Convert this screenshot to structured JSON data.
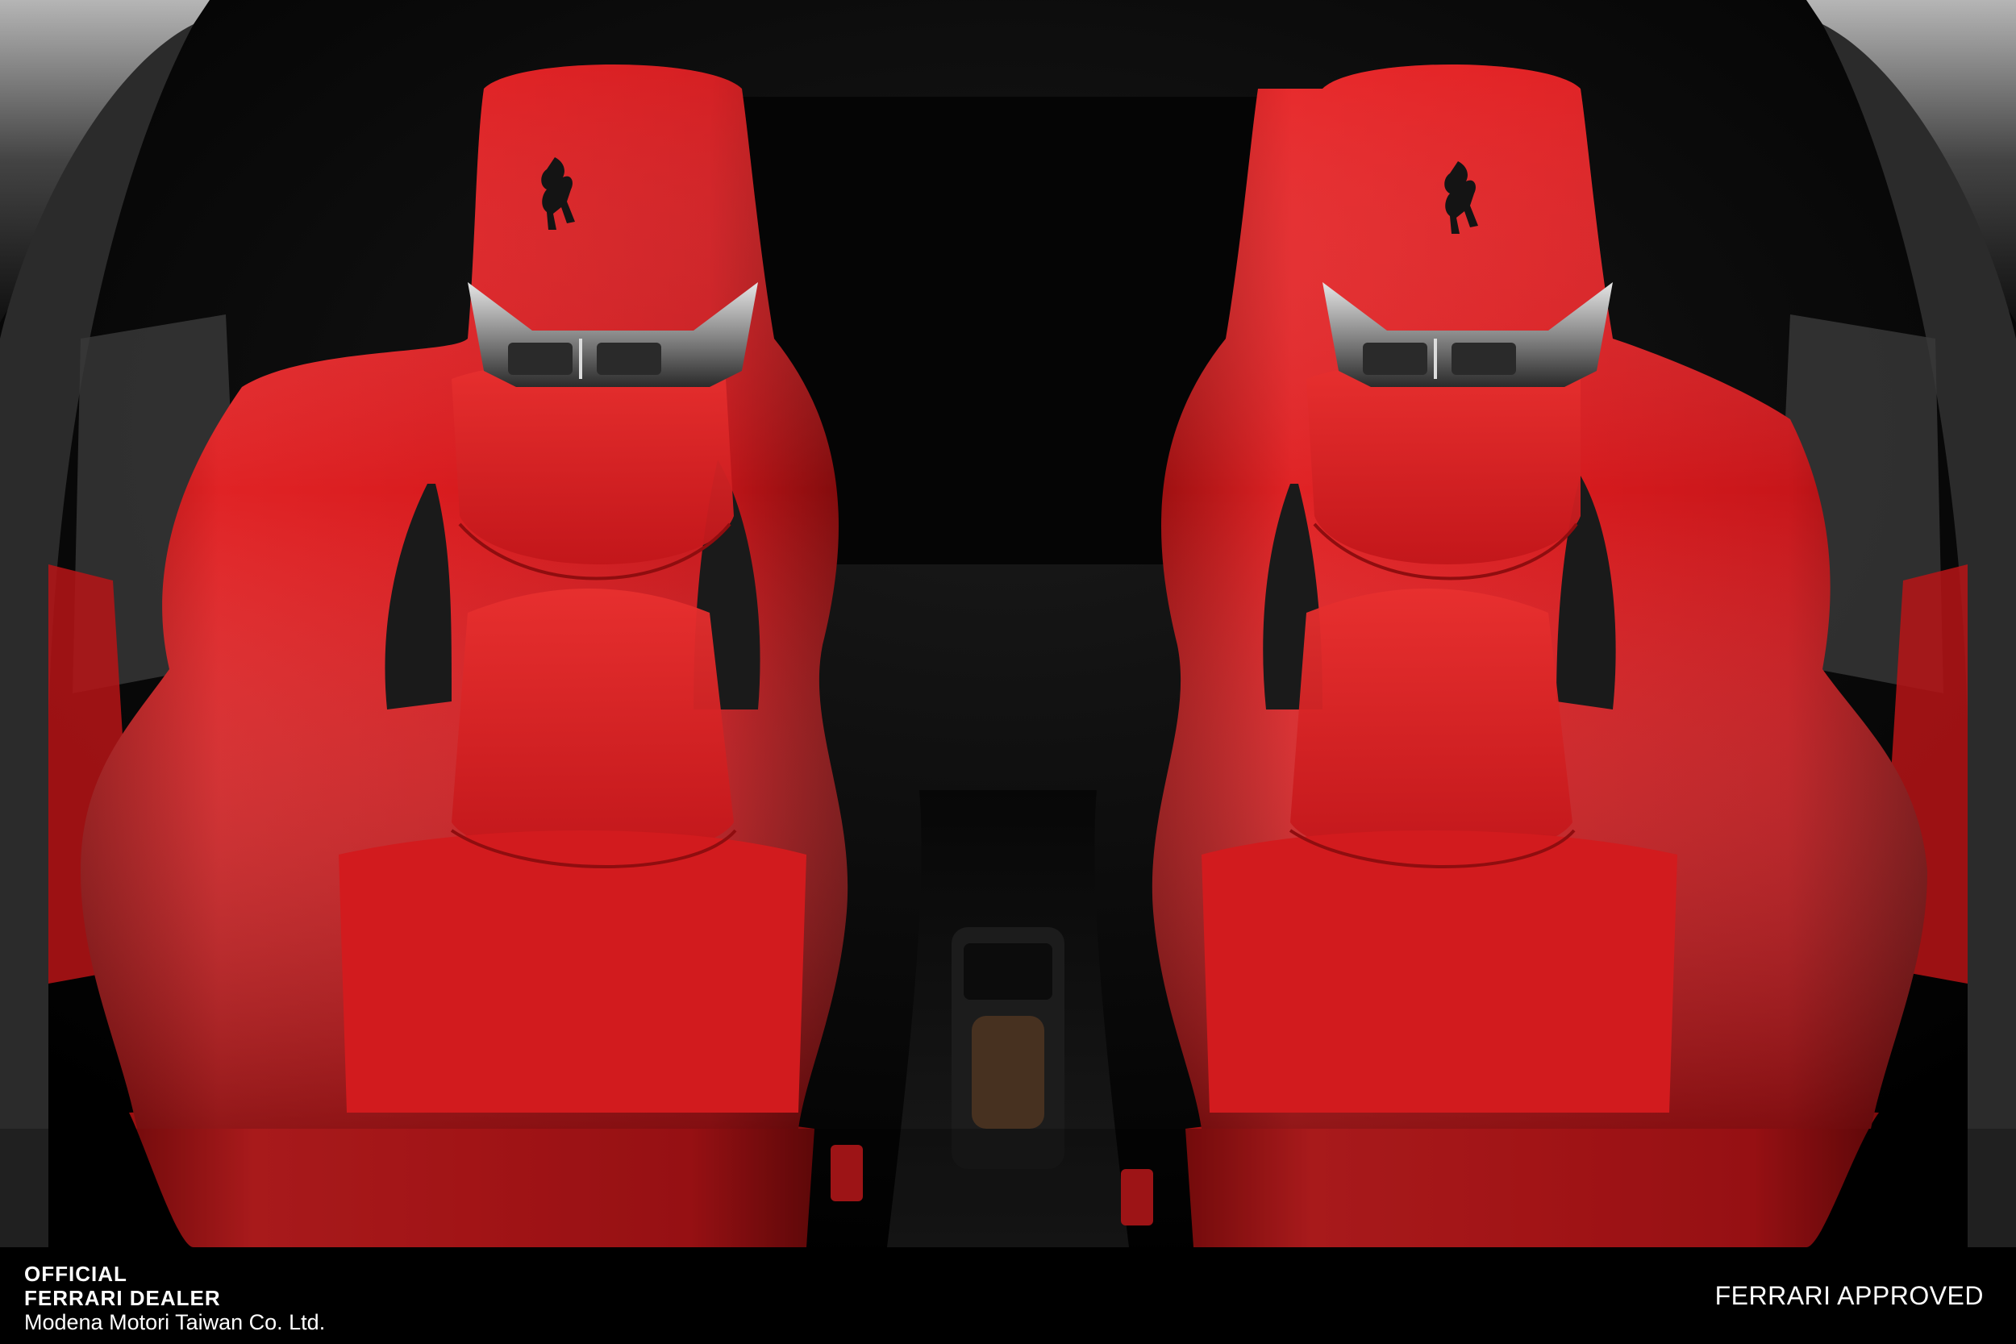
{
  "footer": {
    "official_line1": "OFFICIAL",
    "official_line2": "FERRARI DEALER",
    "dealer_name": "Modena Motori Taiwan Co. Ltd.",
    "approved_label": "FERRARI APPROVED"
  },
  "colors": {
    "leather_red": "#d4191a",
    "leather_red_dark": "#8a0d0d",
    "interior_black": "#0b0b0b",
    "footer_bg": "#000000",
    "footer_text": "#ffffff"
  },
  "photo": {
    "subject": "two red leather sports seats with prancing horse emblems",
    "icons": [
      "prancing-horse-logo",
      "prancing-horse-logo"
    ]
  }
}
